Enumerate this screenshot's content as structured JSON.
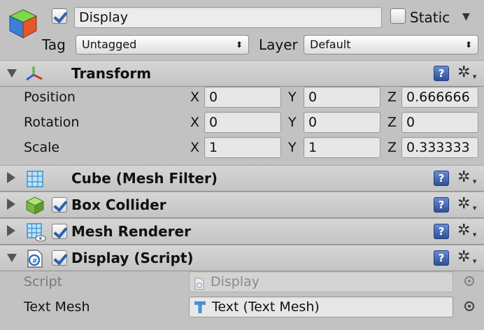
{
  "object": {
    "name": "Display",
    "active": true,
    "static_label": "Static",
    "static_checked": false,
    "tag_label": "Tag",
    "tag_value": "Untagged",
    "layer_label": "Layer",
    "layer_value": "Default",
    "popup_arrows": "⬍"
  },
  "transform": {
    "title": "Transform",
    "rows": [
      {
        "label": "Position",
        "x": "0",
        "y": "0",
        "z": "0.666666"
      },
      {
        "label": "Rotation",
        "x": "0",
        "y": "0",
        "z": "0"
      },
      {
        "label": "Scale",
        "x": "1",
        "y": "1",
        "z": "0.333333"
      }
    ],
    "axis_x": "X",
    "axis_y": "Y",
    "axis_z": "Z"
  },
  "components": {
    "mesh_filter": "Cube (Mesh Filter)",
    "box_collider": "Box Collider",
    "mesh_renderer": "Mesh Renderer",
    "display_script": "Display (Script)"
  },
  "script_section": {
    "script_label": "Script",
    "script_value": "Display",
    "text_mesh_label": "Text Mesh",
    "text_mesh_value": "Text (Text Mesh)"
  },
  "icons": {
    "help": "?",
    "gear": "✲",
    "dropdown": "▼"
  },
  "colors": {
    "background": "#c2c2c2",
    "check_blue": "#2d5fb0",
    "help_blue": "#2e4f98"
  }
}
